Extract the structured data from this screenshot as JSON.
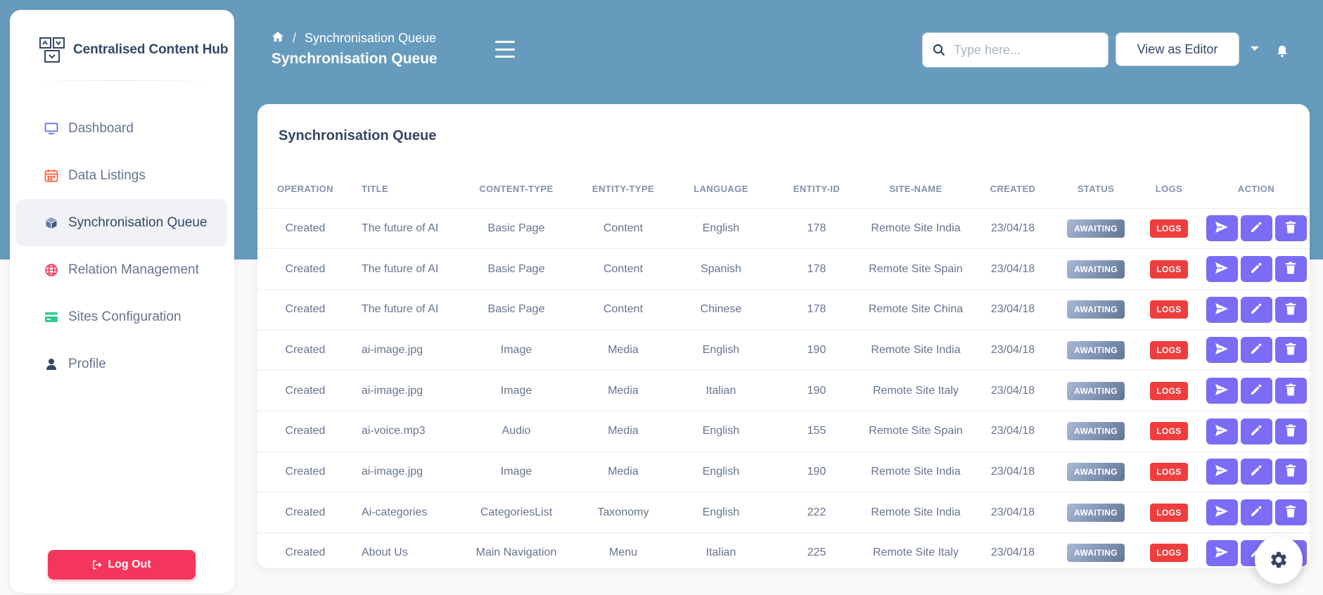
{
  "app": {
    "name": "Centralised Content Hub"
  },
  "sidebar": {
    "items": [
      {
        "label": "Dashboard",
        "icon": "monitor-icon",
        "active": false
      },
      {
        "label": "Data Listings",
        "icon": "calendar-icon",
        "active": false
      },
      {
        "label": "Synchronisation Queue",
        "icon": "cube-icon",
        "active": true
      },
      {
        "label": "Relation Management",
        "icon": "globe-icon",
        "active": false
      },
      {
        "label": "Sites Configuration",
        "icon": "credit-card-icon",
        "active": false
      },
      {
        "label": "Profile",
        "icon": "user-icon",
        "active": false
      }
    ],
    "logout_label": "Log Out"
  },
  "header": {
    "breadcrumb_current": "Synchronisation Queue",
    "title": "Synchronisation Queue",
    "search_placeholder": "Type here...",
    "view_as_label": "View as Editor"
  },
  "card": {
    "title": "Synchronisation Queue"
  },
  "table": {
    "columns": [
      "OPERATION",
      "TITLE",
      "CONTENT-TYPE",
      "ENTITY-TYPE",
      "LANGUAGE",
      "ENTITY-ID",
      "SITE-NAME",
      "CREATED",
      "STATUS",
      "LOGS",
      "ACTION"
    ],
    "rows": [
      {
        "operation": "Created",
        "title": "The future of AI",
        "content_type": "Basic Page",
        "entity_type": "Content",
        "language": "English",
        "entity_id": "178",
        "site_name": "Remote Site India",
        "created": "23/04/18",
        "status": "AWAITING",
        "logs": "LOGS"
      },
      {
        "operation": "Created",
        "title": "The future of AI",
        "content_type": "Basic Page",
        "entity_type": "Content",
        "language": "Spanish",
        "entity_id": "178",
        "site_name": "Remote Site Spain",
        "created": "23/04/18",
        "status": "AWAITING",
        "logs": "LOGS"
      },
      {
        "operation": "Created",
        "title": "The future of AI",
        "content_type": "Basic Page",
        "entity_type": "Content",
        "language": "Chinese",
        "entity_id": "178",
        "site_name": "Remote Site China",
        "created": "23/04/18",
        "status": "AWAITING",
        "logs": "LOGS"
      },
      {
        "operation": "Created",
        "title": "ai-image.jpg",
        "content_type": "Image",
        "entity_type": "Media",
        "language": "English",
        "entity_id": "190",
        "site_name": "Remote Site India",
        "created": "23/04/18",
        "status": "AWAITING",
        "logs": "LOGS"
      },
      {
        "operation": "Created",
        "title": "ai-image.jpg",
        "content_type": "Image",
        "entity_type": "Media",
        "language": "Italian",
        "entity_id": "190",
        "site_name": "Remote Site Italy",
        "created": "23/04/18",
        "status": "AWAITING",
        "logs": "LOGS"
      },
      {
        "operation": "Created",
        "title": "ai-voice.mp3",
        "content_type": "Audio",
        "entity_type": "Media",
        "language": "English",
        "entity_id": "155",
        "site_name": "Remote Site Spain",
        "created": "23/04/18",
        "status": "AWAITING",
        "logs": "LOGS"
      },
      {
        "operation": "Created",
        "title": "ai-image.jpg",
        "content_type": "Image",
        "entity_type": "Media",
        "language": "English",
        "entity_id": "190",
        "site_name": "Remote Site India",
        "created": "23/04/18",
        "status": "AWAITING",
        "logs": "LOGS"
      },
      {
        "operation": "Created",
        "title": "Ai-categories",
        "content_type": "CategoriesList",
        "entity_type": "Taxonomy",
        "language": "English",
        "entity_id": "222",
        "site_name": "Remote Site India",
        "created": "23/04/18",
        "status": "AWAITING",
        "logs": "LOGS"
      },
      {
        "operation": "Created",
        "title": "About Us",
        "content_type": "Main Navigation",
        "entity_type": "Menu",
        "language": "Italian",
        "entity_id": "225",
        "site_name": "Remote Site Italy",
        "created": "23/04/18",
        "status": "AWAITING",
        "logs": "LOGS"
      }
    ]
  },
  "colors": {
    "header_band": "#679bbd",
    "action_button": "#7b6cf6",
    "logs_badge": "#ef3d3d",
    "logout_button": "#f5365c"
  }
}
